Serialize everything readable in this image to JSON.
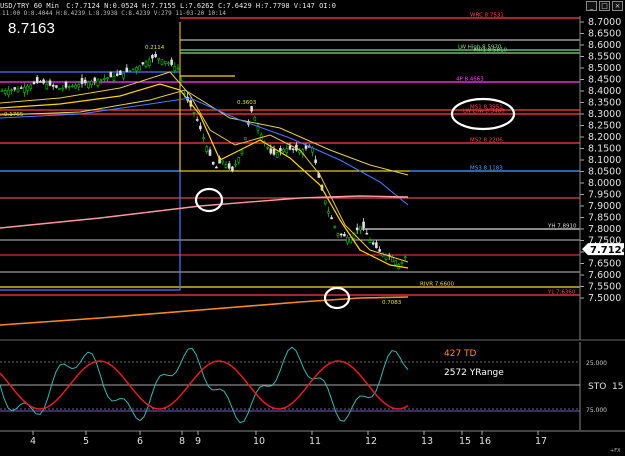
{
  "window": {
    "symbol_title": "USD/TRY 60 Min",
    "quote_line": "C:7.7124  N:0.0524  H:7.7155  L:7.6262  C:7.6429  H:7.7798  V:147  OI:0",
    "sub_line": "11:00  O:8.4044  H:8.4239  L:8.3938  C:8.4239  V:279  11-03-20  10:14",
    "last_price": "8.7163",
    "controls": [
      "_",
      "□",
      "×"
    ]
  },
  "levels": [
    {
      "label": "WRC 8.7531",
      "color": "#ff4040"
    },
    {
      "label": "LW High 8.5970",
      "color": "#7fe07f"
    },
    {
      "label": "MR1 8.5810",
      "color": "#7fe07f"
    },
    {
      "label": "4P 8.4663",
      "color": "#ff40ff"
    },
    {
      "label": "MS1 8.3951",
      "color": "#ff4040"
    },
    {
      "label": "LW Low 8.3468",
      "color": "#ff4040"
    },
    {
      "label": "MS2 8.2206",
      "color": "#ff4040"
    },
    {
      "label": "MS3 8.1183",
      "color": "#4aa3ff"
    },
    {
      "label": "YH 7.8910",
      "color": "#dddddd"
    },
    {
      "label": "RIVR 7.6600",
      "color": "#ffd24a"
    },
    {
      "label": "YL 7.6360",
      "color": "#ff4040"
    }
  ],
  "annotations": {
    "peak_high": "0.2114",
    "mid_high": "0.3603",
    "low_left": "0.1765",
    "low_bottom": "0.7083"
  },
  "price_axis": {
    "ticks": [
      "8.7000",
      "8.6500",
      "8.6000",
      "8.5500",
      "8.5000",
      "8.4500",
      "8.4000",
      "8.3500",
      "8.3000",
      "8.2500",
      "8.2000",
      "8.1500",
      "8.1000",
      "8.0500",
      "8.0000",
      "7.9500",
      "7.9000",
      "7.8500",
      "7.8000",
      "7.7500",
      "7.7000",
      "7.6500",
      "7.6000",
      "7.5500",
      "7.5000"
    ],
    "current": "7.7124"
  },
  "indicator": {
    "td_label": "427 TD",
    "range_label": "2572 YRange",
    "sto_label": "STO",
    "sto_value": "15",
    "ticks": [
      "25.000",
      "75.000"
    ]
  },
  "time_axis": {
    "labels": [
      "4",
      "5",
      "6",
      "8",
      "9",
      "10",
      "11",
      "12",
      "13",
      "15",
      "16",
      "17"
    ],
    "corner_label": "+FX"
  },
  "colors": {
    "up_candle": "#00c000",
    "down_candle": "#e0e0e0",
    "ma_yellow": "#ffd400",
    "ma_gold": "#e8c84a",
    "ma_blue": "#4a78ff",
    "ma_salmon": "#ff9aa0",
    "ma_orange": "#ff8a20",
    "stoch_k": "#40b0b0",
    "stoch_d": "#e02020"
  }
}
